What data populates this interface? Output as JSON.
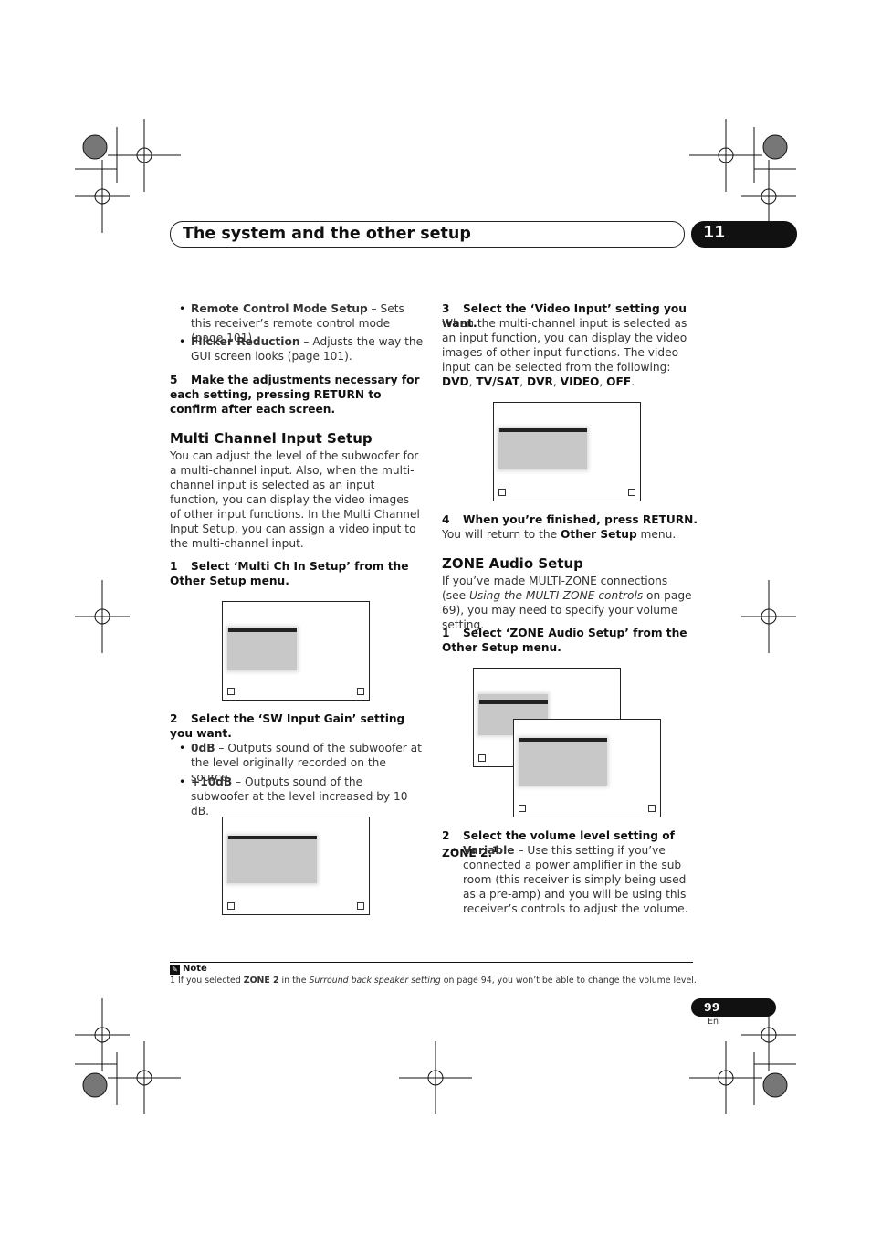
{
  "header": {
    "title": "The system and the other setup",
    "chapter": "11"
  },
  "left": {
    "b1": {
      "bold": "Remote Control Mode Setup",
      "text": " – Sets this receiver’s remote control mode (page 101)."
    },
    "b2": {
      "bold": "Flicker Reduction",
      "text": " – Adjusts the way the GUI screen looks (page 101)."
    },
    "step5": {
      "num": "5",
      "text": "Make the adjustments necessary for each setting, pressing RETURN to confirm after each screen."
    },
    "h_multi": "Multi Channel Input Setup",
    "p_multi": "You can adjust the level of the subwoofer for a multi-channel input. Also, when the multi-channel input is selected as an input function, you can display the video images of other input functions. In the Multi Channel Input Setup, you can assign a video input to the multi-channel input.",
    "step1": {
      "num": "1",
      "text": "Select ‘Multi Ch In Setup’ from the Other Setup menu."
    },
    "step2": {
      "num": "2",
      "text": "Select the ‘SW Input Gain’ setting you want."
    },
    "b3": {
      "bold": "0dB",
      "text": " – Outputs sound of the subwoofer at the level originally recorded on the source."
    },
    "b4": {
      "bold": "+10dB",
      "text": " – Outputs sound of the subwoofer at the level increased by 10 dB."
    }
  },
  "right": {
    "step3": {
      "num": "3",
      "text": "Select the ‘Video Input’ setting you want."
    },
    "p3": {
      "text": "When the multi-channel input is selected as an input function, you can display the video images of other input functions. The video input can be selected from the following: ",
      "opts": [
        "DVD",
        "TV/SAT",
        "DVR",
        "VIDEO",
        "OFF"
      ]
    },
    "step4": {
      "num": "4",
      "text": "When you’re finished, press RETURN."
    },
    "p4": {
      "text": "You will return to the ",
      "bold": "Other Setup",
      "tail": " menu."
    },
    "h_zone": "ZONE Audio Setup",
    "p_zone": {
      "a": "If you’ve made MULTI-ZONE connections (see ",
      "i": "Using the MULTI-ZONE controls",
      "b": " on page 69), you may need to specify your volume setting."
    },
    "step1": {
      "num": "1",
      "text": "Select ‘ZONE Audio Setup’ from the Other Setup menu."
    },
    "step2": {
      "num": "2",
      "text": "Select the volume level setting of ZONE 2.",
      "sup": "1"
    },
    "b1": {
      "bold": "Variable",
      "text": " – Use this setting if you’ve connected a power amplifier in the sub room (this receiver is simply being used as a pre-amp) and you will be using this receiver’s controls to adjust the volume."
    }
  },
  "note": {
    "label": "Note",
    "num": "1",
    "a": " If you selected ",
    "b": "ZONE 2",
    "c": " in the ",
    "i": "Surround back speaker setting",
    "d": " on page 94, you won’t be able to change the volume level."
  },
  "footer": {
    "page": "99",
    "lang": "En"
  }
}
